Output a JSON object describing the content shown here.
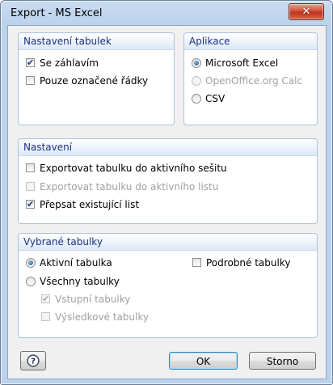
{
  "window": {
    "title": "Export - MS Excel"
  },
  "groups": {
    "tables": {
      "title": "Nastavení tabulek",
      "items": [
        {
          "label": "Se záhlavím",
          "checked": true
        },
        {
          "label": "Pouze označené řádky",
          "checked": false
        }
      ]
    },
    "app": {
      "title": "Aplikace",
      "items": [
        {
          "label": "Microsoft Excel",
          "selected": true,
          "enabled": true
        },
        {
          "label": "OpenOffice.org Calc",
          "selected": false,
          "enabled": false
        },
        {
          "label": "CSV",
          "selected": false,
          "enabled": true
        }
      ]
    },
    "settings": {
      "title": "Nastavení",
      "items": [
        {
          "label": "Exportovat tabulku do aktivního sešitu",
          "checked": false,
          "enabled": true
        },
        {
          "label": "Exportovat tabulku do aktivního listu",
          "checked": false,
          "enabled": false
        },
        {
          "label": "Přepsat existující list",
          "checked": true,
          "enabled": true
        }
      ]
    },
    "selected": {
      "title": "Vybrané tabulky",
      "active": "Aktivní tabulka",
      "all": "Všechny tabulky",
      "input": "Vstupní tabulky",
      "results": "Výsledkové tabulky",
      "detailed": "Podrobné tabulky"
    }
  },
  "buttons": {
    "ok": "OK",
    "cancel": "Storno"
  },
  "icons": {
    "close": "close-icon",
    "help": "help-icon"
  }
}
